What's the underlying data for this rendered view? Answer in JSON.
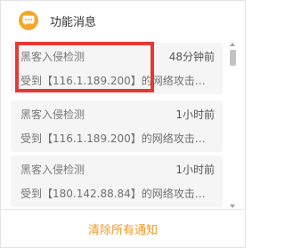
{
  "header": {
    "title": "功能消息",
    "icon": "message-icon",
    "icon_color": "#f4a72b"
  },
  "notifications": [
    {
      "title": "黑客入侵检测",
      "time": "48分钟前",
      "body": "受到【116.1.189.200】的网络攻击，已..."
    },
    {
      "title": "黑客入侵检测",
      "time": "1小时前",
      "body": "受到【116.1.189.200】的网络攻击，已..."
    },
    {
      "title": "黑客入侵检测",
      "time": "1小时前",
      "body": "受到【180.142.88.84】的网络攻击，已..."
    }
  ],
  "footer": {
    "clear_label": "清除所有通知",
    "accent_color": "#f0992a"
  },
  "highlight_color": "#e53935"
}
